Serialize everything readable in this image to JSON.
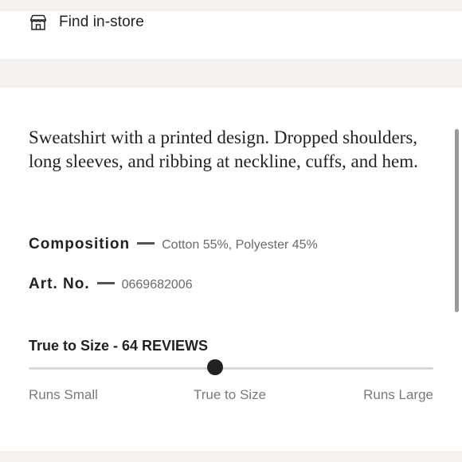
{
  "find_in_store": {
    "label": "Find in-store",
    "icon": "store-icon"
  },
  "product": {
    "description": "Sweatshirt with a printed design. Dropped shoulders, long sleeves, and ribbing at neckline, cuffs, and hem.",
    "composition": {
      "label": "Composition",
      "value": "Cotton 55%, Polyester 45%"
    },
    "art_no": {
      "label": "Art. No.",
      "value": "0669682006"
    }
  },
  "fit": {
    "title": "True to Size - 64 REVIEWS",
    "labels": {
      "small": "Runs Small",
      "true": "True to Size",
      "large": "Runs Large"
    },
    "level": 0.46
  },
  "colors": {
    "band": "#f4f1ef",
    "panel": "#ffffff",
    "text": "#222222",
    "muted": "#6a6a6a",
    "track": "#d8d8d8"
  }
}
